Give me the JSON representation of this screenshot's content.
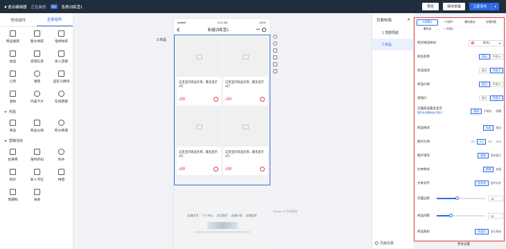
{
  "topbar": {
    "exit_label": "退出编辑器",
    "editing_label": "正在装修",
    "app_badge": "Web",
    "page_name": "急救训练营1",
    "preview_label": "预览",
    "save_draft_label": "保存草稿",
    "publish_label": "立即发布"
  },
  "left_panel": {
    "tabs": [
      {
        "label": "常用组件"
      },
      {
        "label": "全部组件"
      }
    ],
    "group1": [
      {
        "label": "商品搜索"
      },
      {
        "label": "图文导航"
      },
      {
        "label": "电梯导航"
      },
      {
        "label": "拍品"
      },
      {
        "label": "店铺信息"
      },
      {
        "label": "进入店铺"
      },
      {
        "label": "公告"
      },
      {
        "label": "语音"
      },
      {
        "label": "自定义模块"
      },
      {
        "label": "涨粉"
      },
      {
        "label": "内容卡片"
      },
      {
        "label": "在线客服"
      }
    ],
    "section_goods": "商品",
    "group2": [
      {
        "label": "商品"
      },
      {
        "label": "商品分组"
      },
      {
        "label": "积分商城"
      }
    ],
    "section_marketing": "营销活动",
    "group3": [
      {
        "label": "优惠券"
      },
      {
        "label": "限时折扣"
      },
      {
        "label": "秒杀"
      },
      {
        "label": "砍价"
      },
      {
        "label": "新人专区"
      },
      {
        "label": "拼团"
      },
      {
        "label": "周期购"
      },
      {
        "label": "采单"
      }
    ]
  },
  "canvas": {
    "component_count_label": "2 商品",
    "status_bar": {
      "left": "●●●●● ",
      "center": "9:41 AM",
      "right": "100%"
    },
    "nav_title": "新疆训练营1",
    "nav_more": "•••",
    "goods": [
      {
        "title": "这里显示商品名称，最多显示2行",
        "price_symbol": "¥",
        "price": "99"
      },
      {
        "title": "这里显示商品名称，最多显示2行",
        "price_symbol": "¥",
        "price": "99"
      },
      {
        "title": "这里显示商品名称，最多显示2行",
        "price_symbol": "¥",
        "price": "99"
      },
      {
        "title": "这里显示商品名称，最多显示2行",
        "price_symbol": "¥",
        "price": "99"
      }
    ],
    "footer_links": [
      "店铺主页",
      "个人中心",
      "关注我们",
      "店铺介绍",
      "店铺信息"
    ],
    "phone_hint": "iPhone 13 手机预览"
  },
  "layers": {
    "title": "页面布局",
    "items": [
      {
        "label": "1 顶部导航"
      },
      {
        "label": "2 商品"
      }
    ],
    "page_settings": "页面设置"
  },
  "props": {
    "tabs": [
      {
        "label": "大图模式"
      },
      {
        "label": "一行两个"
      },
      {
        "label": "横向滑动"
      },
      {
        "label": "详细列表"
      },
      {
        "label": "瀑布流"
      },
      {
        "label": "一大两小"
      }
    ],
    "purchase_button": {
      "label": "购买按钮样式",
      "value": "样式1"
    },
    "goods_name": {
      "label": "商品名称",
      "options": [
        "显示",
        "不显示"
      ]
    },
    "goods_desc": {
      "label": "商品描述",
      "options": [
        "显示",
        "不显示"
      ]
    },
    "goods_price": {
      "label": "商品价格",
      "options": [
        "显示",
        "不显示"
      ]
    },
    "original_price": {
      "label": "划线价",
      "options": [
        "显示",
        "不显示"
      ]
    },
    "first_goods": {
      "label": "页面商品最多显示",
      "sub": "暂时未设置商品不展示",
      "options": [
        "填充",
        "不填充",
        "隐藏"
      ]
    },
    "goods_style": {
      "label": "商品样式",
      "options": [
        "无边",
        "描边"
      ]
    },
    "image_ratio": {
      "label": "图片比例",
      "options": [
        "3:2",
        "1:1",
        "3:4",
        "16:9"
      ]
    },
    "image_fill": {
      "label": "图片填充",
      "options": [
        "填充",
        "周边留白"
      ]
    },
    "text_style": {
      "label": "文本样式",
      "options": [
        "常规",
        "加粗"
      ]
    },
    "text_align": {
      "label": "文本对齐",
      "options": [
        "左对齐",
        "居中对齐"
      ]
    },
    "page_margin": {
      "label": "页面边距",
      "value": "15"
    },
    "goods_spacing": {
      "label": "商品间距",
      "value": "10"
    },
    "goods_corner": {
      "label": "商品角标",
      "options": [
        "不显示",
        "显示角标"
      ]
    },
    "footer_label": "更多设置"
  }
}
